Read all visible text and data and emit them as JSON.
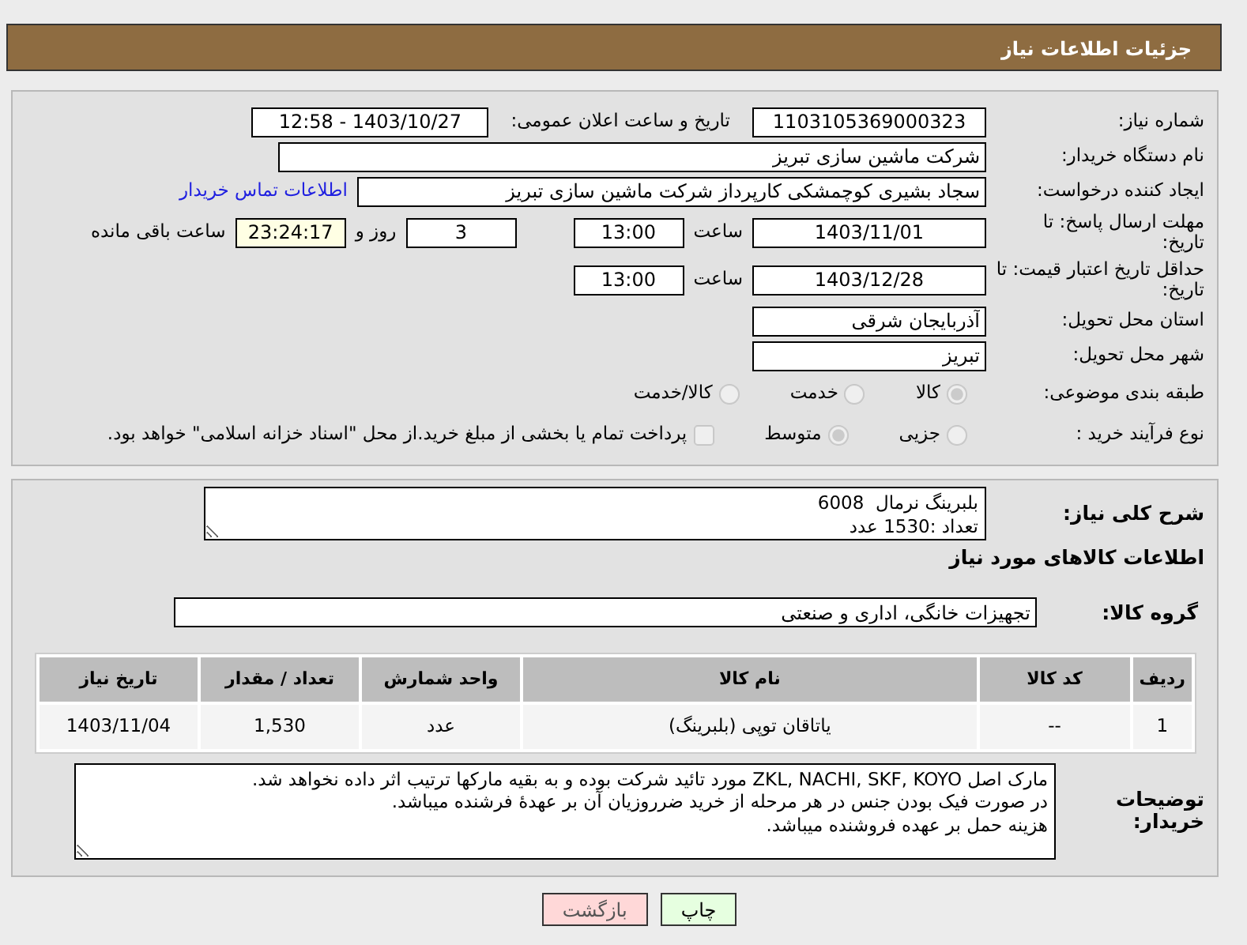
{
  "header": {
    "title": "جزئیات اطلاعات نیاز"
  },
  "need_number": {
    "label": "شماره نیاز:",
    "value": "1103105369000323"
  },
  "announce": {
    "label": "تاریخ و ساعت اعلان عمومی:",
    "value": "1403/10/27 - 12:58"
  },
  "buyer_org": {
    "label": "نام دستگاه خریدار:",
    "value": "شرکت ماشین سازی تبریز"
  },
  "requester": {
    "label": "ایجاد کننده درخواست:",
    "value": "سجاد بشیری کوچمشکی کارپرداز شرکت ماشین سازی تبریز",
    "link": "اطلاعات تماس خریدار"
  },
  "reply_deadline": {
    "label": "مهلت ارسال پاسخ: تا تاریخ:",
    "date": "1403/11/01",
    "time_label": "ساعت",
    "time": "13:00",
    "days": "3",
    "days_label": "روز و",
    "remaining": "23:24:17",
    "remaining_label": "ساعت باقی مانده"
  },
  "price_validity": {
    "label": "حداقل تاریخ اعتبار قیمت: تا تاریخ:",
    "date": "1403/12/28",
    "time_label": "ساعت",
    "time": "13:00"
  },
  "province": {
    "label": "استان محل تحویل:",
    "value": "آذربایجان شرقی"
  },
  "city": {
    "label": "شهر محل تحویل:",
    "value": "تبریز"
  },
  "category": {
    "label": "طبقه بندی موضوعی:",
    "options": [
      {
        "label": "کالا",
        "selected": true
      },
      {
        "label": "خدمت",
        "selected": false
      },
      {
        "label": "کالا/خدمت",
        "selected": false
      }
    ]
  },
  "process": {
    "label": "نوع فرآیند خرید :",
    "options": [
      {
        "label": "جزیی",
        "selected": false
      },
      {
        "label": "متوسط",
        "selected": true
      }
    ],
    "payment": {
      "label": "پرداخت تمام یا بخشی از مبلغ خرید.از محل \"اسناد خزانه اسلامی\" خواهد بود.",
      "checked": false
    }
  },
  "description": {
    "label": "شرح کلی نیاز:",
    "lines": [
      "بلبرینگ نرمال  6008",
      "تعداد :1530 عدد"
    ]
  },
  "goods_title": "اطلاعات کالاهای مورد نیاز",
  "goods_group": {
    "label": "گروه کالا:",
    "value": "تجهیزات خانگی، اداری و صنعتی"
  },
  "table": {
    "columns": [
      "ردیف",
      "کد کالا",
      "نام کالا",
      "واحد شمارش",
      "تعداد / مقدار",
      "تاریخ نیاز"
    ],
    "rows": [
      [
        "1",
        "--",
        "یاتاقان توپی (بلبرینگ)",
        "عدد",
        "1,530",
        "1403/11/04"
      ]
    ]
  },
  "buyer_notes": {
    "label": "توضیحات خریدار:",
    "lines": [
      "مارک اصل ZKL, NACHI, SKF, KOYO مورد تائید شرکت بوده و به بقیه مارکها ترتیب اثر داده نخواهد شد.",
      "در صورت فیک بودن جنس در هر مرحله از خرید ضرروزیان آن بر عهدهٔ فرشنده میباشد.",
      "هزینه حمل بر عهده فروشنده میباشد."
    ]
  },
  "buttons": [
    {
      "label": "چاپ",
      "kind": "print"
    },
    {
      "label": "بازگشت",
      "kind": "back"
    }
  ]
}
